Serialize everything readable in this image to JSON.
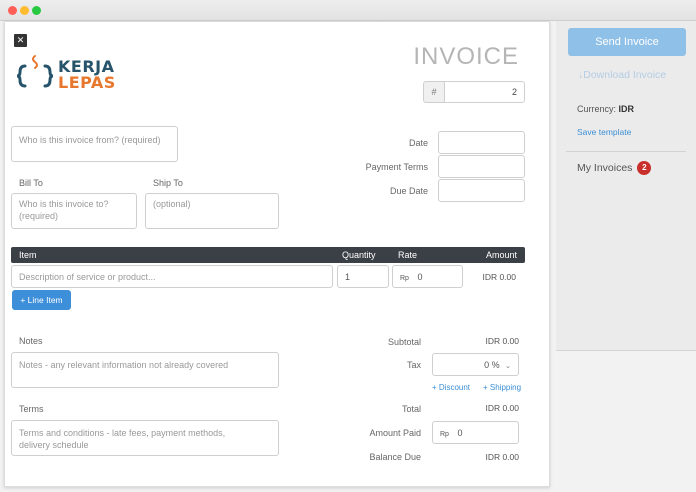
{
  "window": {
    "controls": {
      "close_color": "#ff5f57",
      "minimize_color": "#febc2e",
      "zoom_color": "#28c840"
    }
  },
  "invoice": {
    "close_glyph": "✕",
    "logo": {
      "top_word": "KERJA",
      "bottom_word": "LEPAS",
      "top_color": "#27546b",
      "bottom_color": "#e8772e"
    },
    "title": "INVOICE",
    "number_prefix": "#",
    "number_value": "2",
    "from_placeholder": "Who is this invoice from? (required)",
    "bill_to_label": "Bill To",
    "ship_to_label": "Ship To",
    "bill_to_placeholder": "Who is this invoice to? (required)",
    "ship_to_placeholder": "(optional)",
    "date_label": "Date",
    "payment_terms_label": "Payment Terms",
    "due_date_label": "Due Date",
    "table": {
      "headers": {
        "item": "Item",
        "quantity": "Quantity",
        "rate": "Rate",
        "amount": "Amount"
      },
      "row": {
        "description_placeholder": "Description of service or product...",
        "quantity": "1",
        "rate_prefix": "Rp",
        "rate": "0",
        "amount": "IDR 0.00"
      }
    },
    "line_item_button": "+ Line Item",
    "notes_label": "Notes",
    "notes_placeholder": "Notes - any relevant information not already covered",
    "terms_label": "Terms",
    "terms_placeholder": "Terms and conditions - late fees, payment methods, delivery schedule",
    "totals": {
      "subtotal_label": "Subtotal",
      "subtotal_value": "IDR 0.00",
      "tax_label": "Tax",
      "tax_value": "0 %",
      "discount_link": "+ Discount",
      "shipping_link": "+ Shipping",
      "total_label": "Total",
      "total_value": "IDR 0.00",
      "amount_paid_label": "Amount Paid",
      "amount_paid_prefix": "Rp",
      "amount_paid_value": "0",
      "balance_due_label": "Balance Due",
      "balance_due_value": "IDR 0.00"
    }
  },
  "sidebar": {
    "send_button": "Send Invoice",
    "download_link": "Download Invoice",
    "currency_label": "Currency:",
    "currency_value": "IDR",
    "save_template": "Save template",
    "my_invoices": "My Invoices",
    "my_invoices_count": "2"
  },
  "colors": {
    "accent": "#3c8fd8",
    "send_button_bg": "#8fc0e8",
    "table_header_bg": "#3b4047",
    "badge": "#c9302c"
  }
}
